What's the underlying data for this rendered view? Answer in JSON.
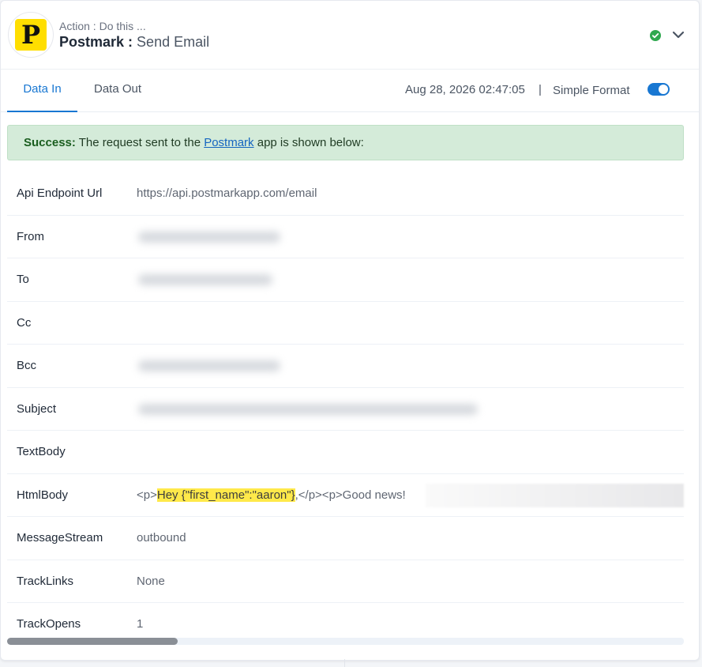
{
  "header": {
    "action_label": "Action : Do this ...",
    "app_name": "Postmark",
    "separator": " : ",
    "event_name": "Send Email",
    "logo_letter": "P",
    "logo_color": "#ffde00",
    "status_icon": "check-circle-icon",
    "status_color": "#2fa84f",
    "expand_icon": "chevron-down-icon"
  },
  "tabs": [
    {
      "label": "Data In",
      "active": true
    },
    {
      "label": "Data Out",
      "active": false
    }
  ],
  "toolbar": {
    "timestamp": "Aug 28, 2026 02:47:05",
    "separator": "|",
    "simple_format_label": "Simple Format",
    "simple_format_on": true
  },
  "banner": {
    "strong": "Success:",
    "text_before": " The request sent to the ",
    "link": "Postmark",
    "text_after": " app is shown below:"
  },
  "fields": [
    {
      "key": "Api Endpoint Url",
      "value": "https://api.postmarkapp.com/email"
    },
    {
      "key": "From",
      "value": ""
    },
    {
      "key": "To",
      "value": ""
    },
    {
      "key": "Cc",
      "value": ""
    },
    {
      "key": "Bcc",
      "value": ""
    },
    {
      "key": "Subject",
      "value": ""
    },
    {
      "key": "TextBody",
      "value": ""
    },
    {
      "key": "HtmlBody",
      "value_prefix": "<p>",
      "value_highlight": "Hey {\"first_name\":\"aaron\"}",
      "value_suffix": ",</p><p>Good news!"
    },
    {
      "key": "MessageStream",
      "value": "outbound"
    },
    {
      "key": "TrackLinks",
      "value": "None"
    },
    {
      "key": "TrackOpens",
      "value": "1"
    }
  ],
  "colors": {
    "accent": "#1877d2",
    "success_bg": "#d4ebd9",
    "highlight": "#ffe94a"
  }
}
